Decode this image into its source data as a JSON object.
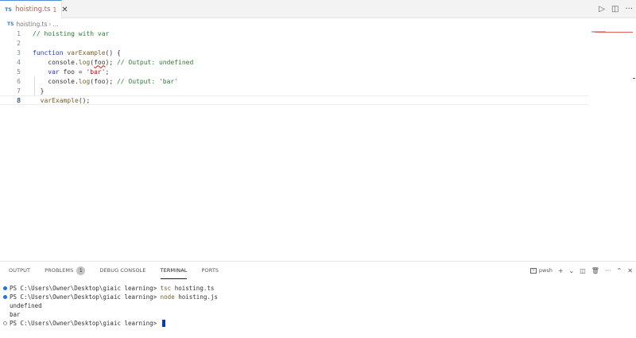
{
  "tab": {
    "badge": "TS",
    "filename": "hoisting.ts",
    "problems": "1",
    "close": "✕"
  },
  "tab_actions": {
    "run": "▷",
    "split": "◫",
    "more": "···"
  },
  "breadcrumb": {
    "badge": "TS",
    "file": "hoisting.ts",
    "sep": "›",
    "rest": "..."
  },
  "editor": {
    "lines": [
      {
        "n": "1",
        "parts": [
          {
            "t": "// hoisting with var",
            "c": "cmt"
          }
        ]
      },
      {
        "n": "2",
        "parts": []
      },
      {
        "n": "3",
        "parts": [
          {
            "t": "function",
            "c": "kw"
          },
          {
            "t": " "
          },
          {
            "t": "varExample",
            "c": "fn"
          },
          {
            "t": "() {"
          }
        ]
      },
      {
        "n": "4",
        "parts": [
          {
            "t": "    console."
          },
          {
            "t": "log",
            "c": "fn"
          },
          {
            "t": "("
          },
          {
            "t": "foo",
            "c": "squiggle"
          },
          {
            "t": "); "
          },
          {
            "t": "// Output: undefined",
            "c": "cmt"
          }
        ]
      },
      {
        "n": "5",
        "parts": [
          {
            "t": "    "
          },
          {
            "t": "var",
            "c": "kw"
          },
          {
            "t": " foo = "
          },
          {
            "t": "'bar'",
            "c": "str"
          },
          {
            "t": ";"
          }
        ]
      },
      {
        "n": "6",
        "parts": [
          {
            "t": "    console."
          },
          {
            "t": "log",
            "c": "fn"
          },
          {
            "t": "(foo); "
          },
          {
            "t": "// Output: 'bar'",
            "c": "cmt"
          }
        ]
      },
      {
        "n": "7",
        "parts": [
          {
            "t": "  }"
          }
        ]
      },
      {
        "n": "8",
        "parts": [
          {
            "t": "  "
          },
          {
            "t": "varExample",
            "c": "fn"
          },
          {
            "t": "();"
          }
        ],
        "active": true
      }
    ]
  },
  "panel": {
    "tabs": [
      {
        "label": "OUTPUT"
      },
      {
        "label": "PROBLEMS",
        "badge": "1"
      },
      {
        "label": "DEBUG CONSOLE"
      },
      {
        "label": "TERMINAL",
        "active": true
      },
      {
        "label": "PORTS"
      }
    ],
    "shell": "pwsh",
    "actions": {
      "add": "+",
      "chevron": "⌄",
      "split": "◫",
      "trash": "🗑",
      "more": "···",
      "maximize": "⌃",
      "close": "✕"
    }
  },
  "terminal": {
    "lines": [
      {
        "dot": "blue",
        "prompt": "PS C:\\Users\\Owner\\Desktop\\giaic learning> ",
        "cmd": "tsc",
        "args": " hoisting.ts"
      },
      {
        "dot": "blue",
        "prompt": "PS C:\\Users\\Owner\\Desktop\\giaic learning> ",
        "cmd": "node",
        "args": " hoisting.js"
      },
      {
        "dot": "none",
        "text": "undefined"
      },
      {
        "dot": "none",
        "text": "bar"
      },
      {
        "dot": "hollow",
        "prompt": "PS C:\\Users\\Owner\\Desktop\\giaic learning> ",
        "cursor": true
      }
    ]
  },
  "colors": {
    "accent": "#1a73e8",
    "tab_error": "#c7584f",
    "comment": "#2e7d32",
    "keyword": "#1f3ccb",
    "string": "#a31515"
  }
}
